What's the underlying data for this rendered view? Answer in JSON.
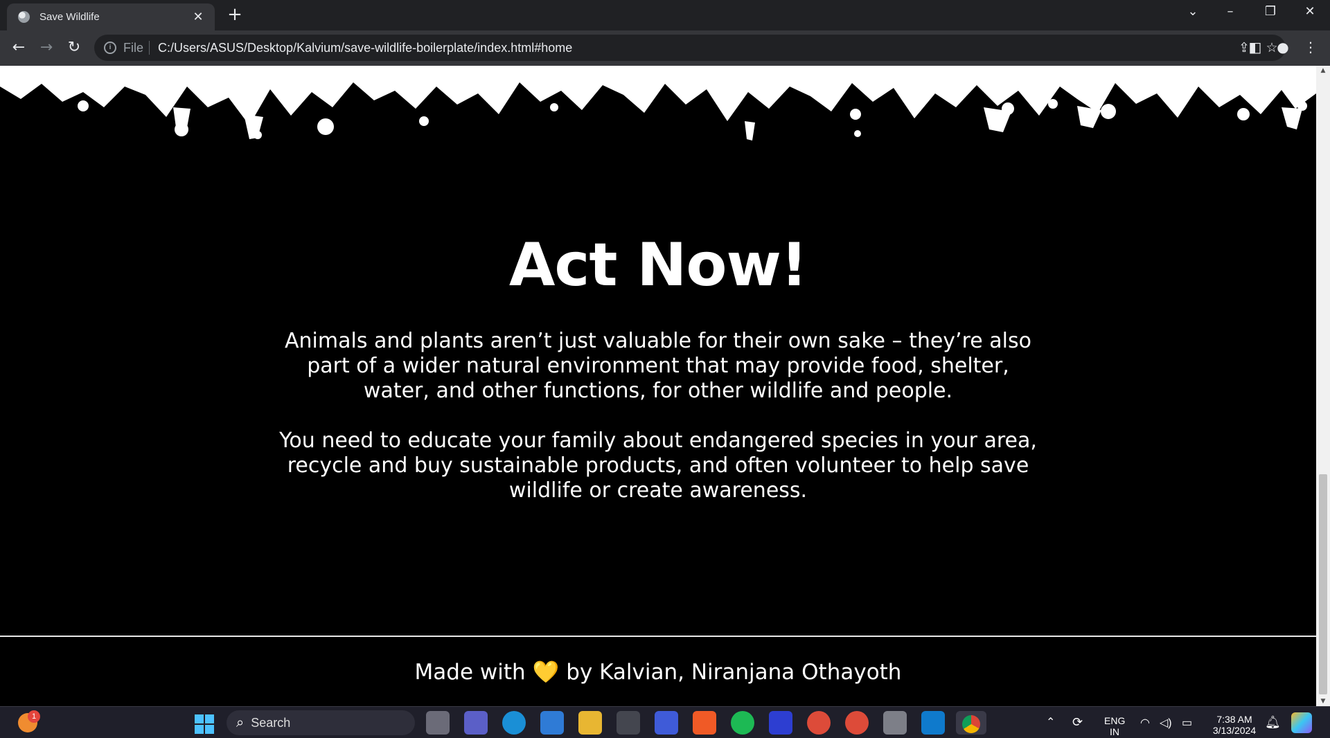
{
  "browser": {
    "tab_title": "Save Wildlife",
    "url_scheme": "File",
    "url": "C:/Users/ASUS/Desktop/Kalvium/save-wildlife-boilerplate/index.html#home"
  },
  "page": {
    "heading": "Act Now!",
    "paragraph1": "Animals and plants aren’t just valuable for their own sake – they’re also part of a wider natural environment that may provide food, shelter, water, and other functions, for other wildlife and people.",
    "paragraph2": "You need to educate your family about endangered species in your area, recycle and buy sustainable products, and often volunteer to help save wildlife or create awareness.",
    "footer_prefix": "Made with",
    "footer_heart": "💛",
    "footer_suffix": "by Kalvian, Niranjana Othayoth"
  },
  "taskbar": {
    "search_placeholder": "Search",
    "notification_badge": "1",
    "language": "ENG",
    "region": "IN",
    "time": "7:38 AM",
    "date": "3/13/2024",
    "pinned_apps": [
      "file-explorer-icon",
      "meet-icon",
      "edge-icon",
      "store-icon",
      "folder-icon",
      "app-icon",
      "app-icon",
      "brave-icon",
      "spotify-icon",
      "app-icon",
      "chrome-icon",
      "chrome-icon",
      "calculator-icon",
      "vscode-icon",
      "chrome-icon"
    ]
  },
  "colors": {
    "page_bg": "#000000",
    "chrome_dark": "#202124",
    "chrome_mid": "#35363a",
    "heart": "#ffd54a"
  }
}
